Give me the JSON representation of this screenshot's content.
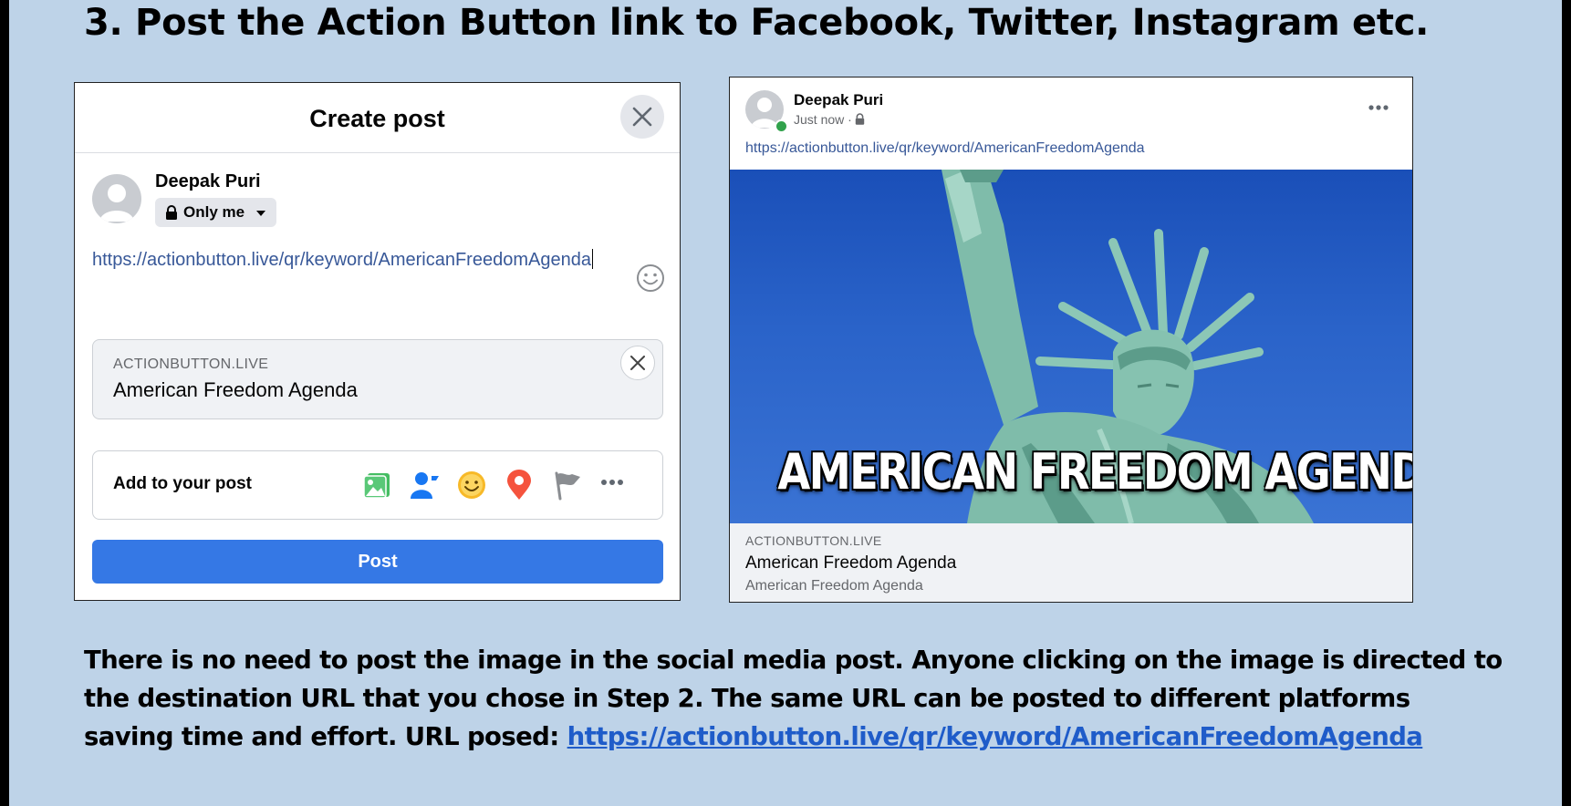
{
  "heading": "3. Post the Action Button link to Facebook, Twitter, Instagram etc.",
  "create_post": {
    "title": "Create post",
    "user_name": "Deepak Puri",
    "audience": "Only me",
    "text": "https://actionbutton.live/qr/keyword/AmericanFreedomAgenda",
    "link_preview": {
      "domain": "ACTIONBUTTON.LIVE",
      "title": "American Freedom Agenda"
    },
    "add_to_post_label": "Add to your post",
    "add_icons": [
      "photo-icon",
      "tag-people-icon",
      "feeling-icon",
      "location-icon",
      "flag-icon",
      "more-icon"
    ],
    "post_button": "Post",
    "colors": {
      "primary": "#3578e5",
      "link": "#385898"
    }
  },
  "published_post": {
    "user_name": "Deepak Puri",
    "timestamp": "Just now ·",
    "link": "https://actionbutton.live/qr/keyword/AmericanFreedomAgenda",
    "image_caption": "AMERICAN FREEDOM AGENDA",
    "footer": {
      "domain": "ACTIONBUTTON.LIVE",
      "title": "American Freedom Agenda",
      "description": "American Freedom Agenda"
    }
  },
  "body": {
    "text": "There is no need to post the image in the social media post. Anyone clicking on the image is directed to the destination URL that you chose in Step 2. The same URL can be posted to different platforms saving time and effort. URL posed: ",
    "url": "https://actionbutton.live/qr/keyword/AmericanFreedomAgenda"
  },
  "colors": {
    "slide_bg": "#bed3e8",
    "frame": "#000000"
  }
}
